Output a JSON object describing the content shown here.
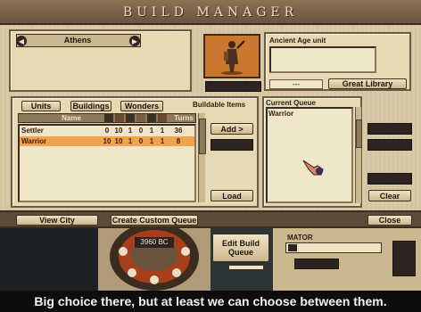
{
  "window": {
    "title": "BUILD MANAGER"
  },
  "city": {
    "name": "Athens",
    "prev_arrow": "◀",
    "next_arrow": "▶"
  },
  "unit_info": {
    "description": "Ancient Age unit",
    "field_value": "---",
    "great_library_label": "Great Library"
  },
  "tabs": {
    "units": "Units",
    "buildings": "Buildings",
    "wonders": "Wonders"
  },
  "buildable": {
    "heading": "Buildable Items",
    "column_name": "Name",
    "column_turns": "Turns",
    "rows": [
      {
        "name": "Settler",
        "stats": [
          "0",
          "10",
          "1",
          "0",
          "1",
          "1"
        ],
        "turns": "36"
      },
      {
        "name": "Warrior",
        "stats": [
          "10",
          "10",
          "1",
          "0",
          "1",
          "1"
        ],
        "turns": "8"
      }
    ]
  },
  "actions": {
    "add": "Add >",
    "load": "Load",
    "clear": "Clear"
  },
  "queue": {
    "heading": "Current Queue",
    "items": [
      "Warrior"
    ]
  },
  "footer": {
    "view_city": "View City",
    "create_custom_queue": "Create Custom Queue",
    "close": "Close"
  },
  "hud": {
    "year": "3960 BC",
    "edit_build_queue_line1": "Edit Build",
    "edit_build_queue_line2": "Queue",
    "leader_label": "MATOR"
  },
  "caption": "Big choice there, but at least we can choose between them.",
  "colors": {
    "selected_row": "#f2a24a",
    "title_bar": "#7a6149",
    "caption_bg": "#0d0d0f"
  }
}
